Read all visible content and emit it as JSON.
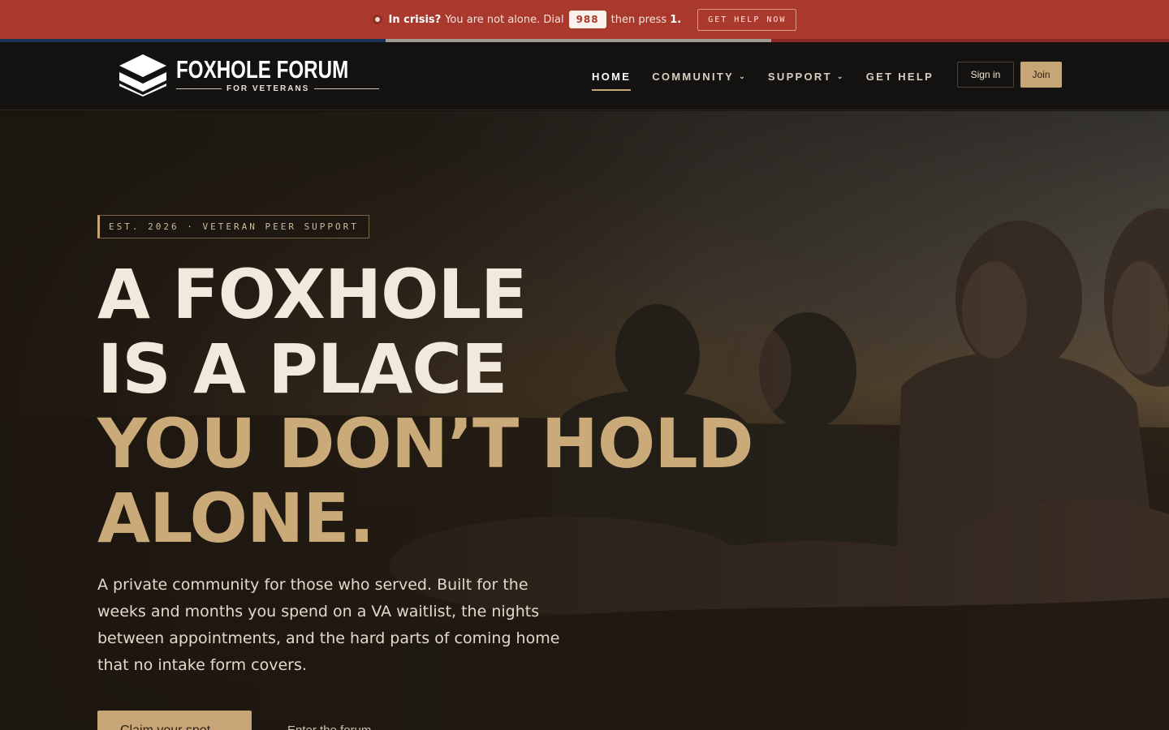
{
  "crisis_bar": {
    "lead": "In crisis?",
    "text1": "You are not alone. Dial",
    "number": "988",
    "text2": "then press",
    "press_number": "1.",
    "button": "GET HELP NOW"
  },
  "header": {
    "logo_title": "FOXHOLE FORUM",
    "logo_sub": "FOR VETERANS",
    "nav": [
      {
        "label": "HOME",
        "active": true
      },
      {
        "label": "COMMUNITY",
        "dropdown": true
      },
      {
        "label": "SUPPORT",
        "dropdown": true
      },
      {
        "label": "GET HELP"
      }
    ],
    "sign_in": "Sign in",
    "join": "Join"
  },
  "hero": {
    "tag": "EST. 2026 · VETERAN PEER SUPPORT",
    "headline": [
      "A FOXHOLE",
      "IS A PLACE",
      "YOU DON’T HOLD",
      "ALONE."
    ],
    "lead": "A private community for those who served. Built for the weeks and months you spend on a VA waitlist, the nights between appointments, and the hard parts of coming home that no intake form covers.",
    "cta_primary": "Claim your spot",
    "cta_secondary": "Enter the forum"
  },
  "colors": {
    "crisis_red": "#a8392c",
    "accent_tan": "#c8a576",
    "header_bg": "#141210"
  }
}
